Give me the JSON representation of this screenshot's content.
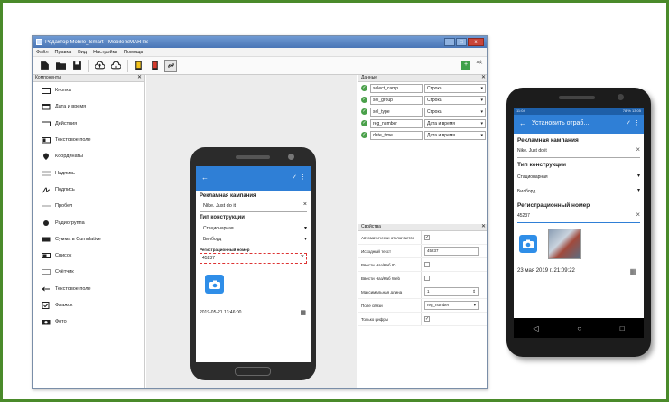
{
  "window": {
    "title": "Редактор Mobile_Smart - Mobile SMARTS",
    "controls": {
      "minimize": "–",
      "maximize": "□",
      "close": "x"
    }
  },
  "menu": [
    "Файл",
    "Правка",
    "Вид",
    "Настройки",
    "Помощь"
  ],
  "toolbar": {
    "badge": "+",
    "translate": "Ā文"
  },
  "components": {
    "title": "Компоненты",
    "items": [
      {
        "label": "Кнопка",
        "icon": "button-icon"
      },
      {
        "label": "Дата и время",
        "icon": "datetime-icon"
      },
      {
        "label": "Действия",
        "icon": "actions-icon"
      },
      {
        "label": "Текстовое поле",
        "icon": "textfield-icon"
      },
      {
        "label": "Координаты",
        "icon": "location-pin-icon"
      },
      {
        "label": "Надпись",
        "icon": "label-icon"
      },
      {
        "label": "Подпись",
        "icon": "signature-icon"
      },
      {
        "label": "Пробел",
        "icon": "space-icon"
      },
      {
        "label": "Радиогруппа",
        "icon": "radiogroup-icon"
      },
      {
        "label": "Сумма в Cumulative",
        "icon": "sum-icon"
      },
      {
        "label": "Список",
        "icon": "list-icon"
      },
      {
        "label": "Счётчик",
        "icon": "counter-icon"
      },
      {
        "label": "Текстовое поле",
        "icon": "text-input-icon"
      },
      {
        "label": "Флажок",
        "icon": "checkbox-icon"
      },
      {
        "label": "Фото",
        "icon": "camera-icon"
      }
    ]
  },
  "designer": {
    "section1": "Рекламная кампания",
    "field1": "Nike. Just do it",
    "section2": "Тип конструкции",
    "select1": "Стационарная",
    "select2": "Билборд",
    "hint": "Регистрационный номер",
    "field2": "45237",
    "date": "2019-05-21 13:46:00"
  },
  "data_panel": {
    "title": "Данные",
    "rows": [
      {
        "name": "select_camp",
        "type": "Строка"
      },
      {
        "name": "sel_group",
        "type": "Строка"
      },
      {
        "name": "sel_type",
        "type": "Строка"
      },
      {
        "name": "reg_number",
        "type": "Дата и время"
      },
      {
        "name": "date_time",
        "type": "Дата и время"
      }
    ]
  },
  "properties": {
    "title": "Свойства",
    "rows": [
      {
        "key": "Автоматически отключается",
        "type": "check",
        "value": "✓"
      },
      {
        "key": "Исходный текст",
        "type": "text",
        "value": "45237"
      },
      {
        "key": "Ввести Наз/Каб ID",
        "type": "check",
        "value": ""
      },
      {
        "key": "Ввести Наз/Каб Web",
        "type": "check",
        "value": ""
      },
      {
        "key": "Максимальная длина",
        "type": "spin",
        "value": "1"
      },
      {
        "key": "Поле связи",
        "type": "select",
        "value": "reg_number"
      },
      {
        "key": "Только цифры",
        "type": "check",
        "value": "✓"
      }
    ]
  },
  "phone": {
    "status_left": "11:04",
    "status_right": "78 % 13:05",
    "title": "Установить отраб...",
    "section1": "Рекламная кампания",
    "field1": "Nike. Just do it",
    "section2": "Тип конструкции",
    "select1": "Стационарная",
    "select2": "Билборд",
    "section3": "Регистрационный номер",
    "field2": "45237",
    "date": "23 мая 2019 г. 21:09:22",
    "nav": {
      "back": "◁",
      "home": "○",
      "recent": "□"
    }
  }
}
